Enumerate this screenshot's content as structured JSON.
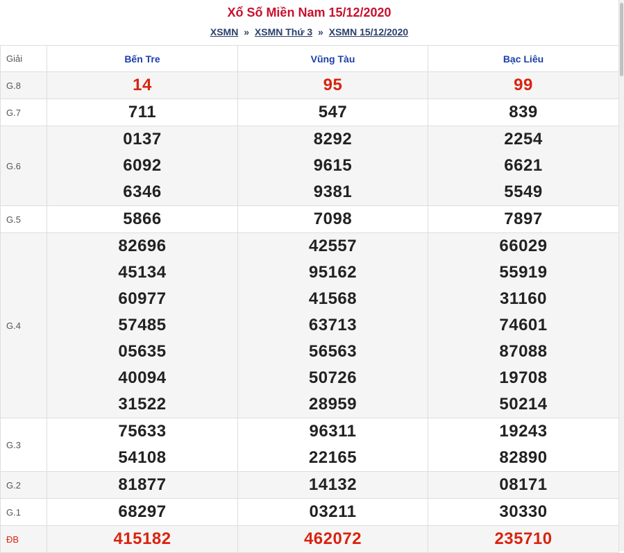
{
  "title": "Xổ Số Miền Nam 15/12/2020",
  "breadcrumb": {
    "items": [
      "XSMN",
      "XSMN Thứ 3",
      "XSMN 15/12/2020"
    ],
    "separator": "»"
  },
  "table": {
    "header": {
      "label": "Giải",
      "provinces": [
        "Bến Tre",
        "Vũng Tàu",
        "Bạc Liêu"
      ]
    },
    "rows": [
      {
        "label": "G.8",
        "highlight": true,
        "values": [
          [
            "14"
          ],
          [
            "95"
          ],
          [
            "99"
          ]
        ]
      },
      {
        "label": "G.7",
        "highlight": false,
        "values": [
          [
            "711"
          ],
          [
            "547"
          ],
          [
            "839"
          ]
        ]
      },
      {
        "label": "G.6",
        "highlight": false,
        "values": [
          [
            "0137",
            "6092",
            "6346"
          ],
          [
            "8292",
            "9615",
            "9381"
          ],
          [
            "2254",
            "6621",
            "5549"
          ]
        ]
      },
      {
        "label": "G.5",
        "highlight": false,
        "values": [
          [
            "5866"
          ],
          [
            "7098"
          ],
          [
            "7897"
          ]
        ]
      },
      {
        "label": "G.4",
        "highlight": false,
        "values": [
          [
            "82696",
            "45134",
            "60977",
            "57485",
            "05635",
            "40094",
            "31522"
          ],
          [
            "42557",
            "95162",
            "41568",
            "63713",
            "56563",
            "50726",
            "28959"
          ],
          [
            "66029",
            "55919",
            "31160",
            "74601",
            "87088",
            "19708",
            "50214"
          ]
        ]
      },
      {
        "label": "G.3",
        "highlight": false,
        "values": [
          [
            "75633",
            "54108"
          ],
          [
            "96311",
            "22165"
          ],
          [
            "19243",
            "82890"
          ]
        ]
      },
      {
        "label": "G.2",
        "highlight": false,
        "values": [
          [
            "81877"
          ],
          [
            "14132"
          ],
          [
            "08171"
          ]
        ]
      },
      {
        "label": "G.1",
        "highlight": false,
        "values": [
          [
            "68297"
          ],
          [
            "03211"
          ],
          [
            "30330"
          ]
        ]
      },
      {
        "label": "ĐB",
        "highlight": true,
        "values": [
          [
            "415182"
          ],
          [
            "462072"
          ],
          [
            "235710"
          ]
        ]
      }
    ]
  },
  "colors": {
    "title": "#c8102e",
    "breadcrumb": "#2a3f6b",
    "province_header": "#1a3fa8",
    "highlight_number": "#d9230f",
    "number": "#222222",
    "alt_row_bg": "#f5f5f5"
  }
}
